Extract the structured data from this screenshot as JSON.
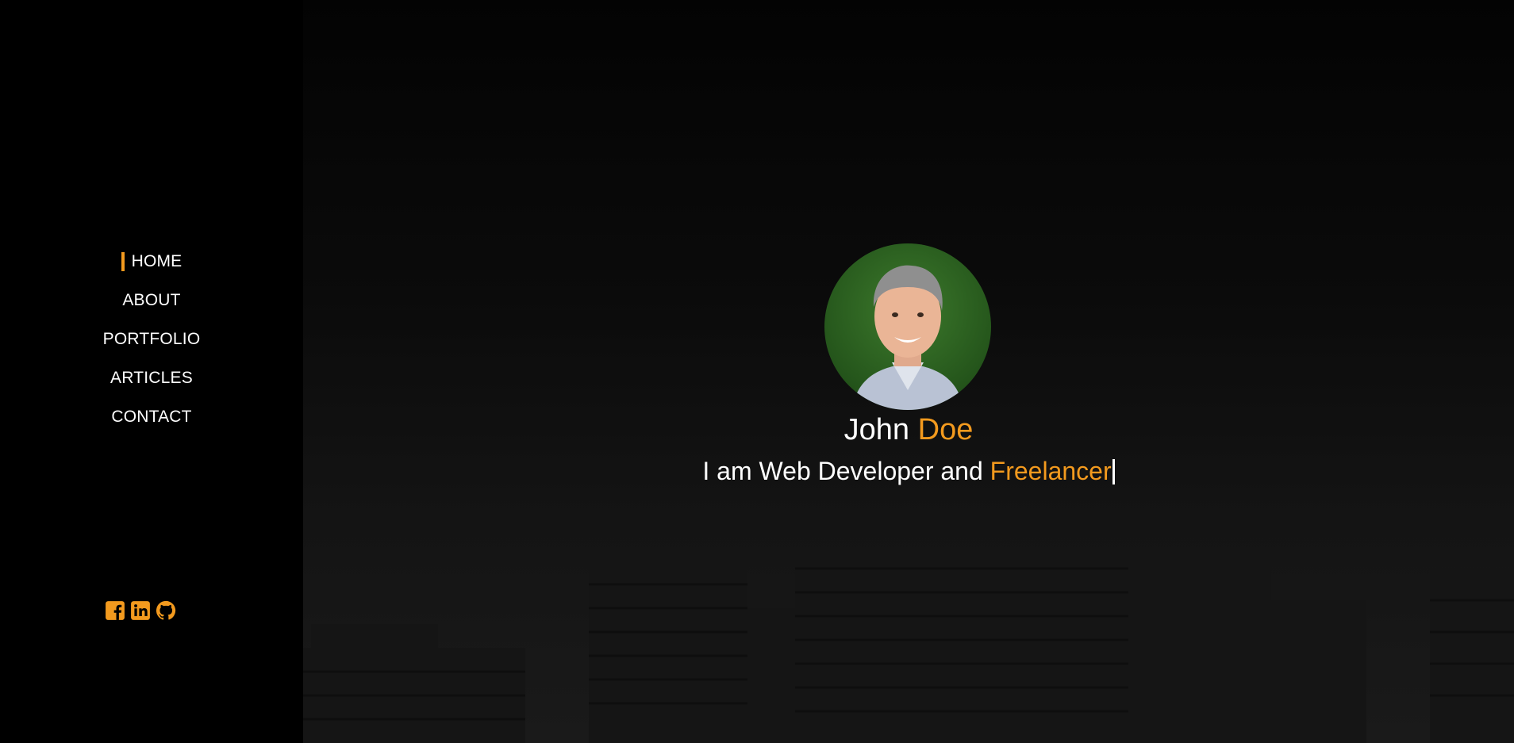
{
  "nav": {
    "items": [
      {
        "label": "HOME",
        "active": true
      },
      {
        "label": "ABOUT",
        "active": false
      },
      {
        "label": "PORTFOLIO",
        "active": false
      },
      {
        "label": "ARTICLES",
        "active": false
      },
      {
        "label": "CONTACT",
        "active": false
      }
    ]
  },
  "socials": [
    {
      "icon": "facebook-icon"
    },
    {
      "icon": "linkedin-icon"
    },
    {
      "icon": "github-icon"
    }
  ],
  "hero": {
    "first_name": "John",
    "last_name": "Doe",
    "tagline_prefix": "I am Web Developer and",
    "tagline_highlight": "Freelancer"
  },
  "colors": {
    "accent": "#f39a1e",
    "sidebar_bg": "#000000",
    "text": "#ffffff"
  }
}
